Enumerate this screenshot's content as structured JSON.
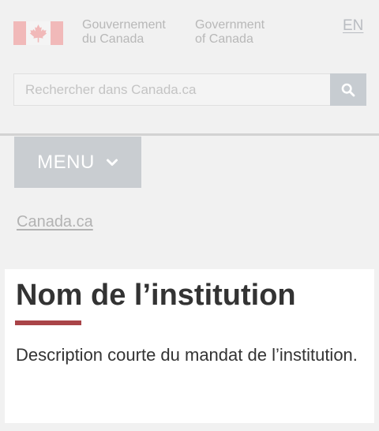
{
  "header": {
    "signature_fr_line1": "Gouvernement",
    "signature_fr_line2": "du Canada",
    "signature_en_line1": "Government",
    "signature_en_line2": "of Canada",
    "language_toggle": "EN",
    "flag_icon": "canada-flag-icon"
  },
  "search": {
    "placeholder": "Rechercher dans Canada.ca",
    "value": "",
    "button_icon": "search-icon"
  },
  "menu": {
    "label": "MENU",
    "icon": "chevron-down-icon"
  },
  "breadcrumb": {
    "label": "Canada.ca"
  },
  "main": {
    "title": "Nom de l’institution",
    "description": "Description courte du mandat de l’institution."
  },
  "colors": {
    "background": "#f1f1f1",
    "card": "#ffffff",
    "flag_red": "#f1b9b9",
    "title_underline": "#a94448",
    "button_gray": "#c9cdd1",
    "text": "#333333"
  }
}
